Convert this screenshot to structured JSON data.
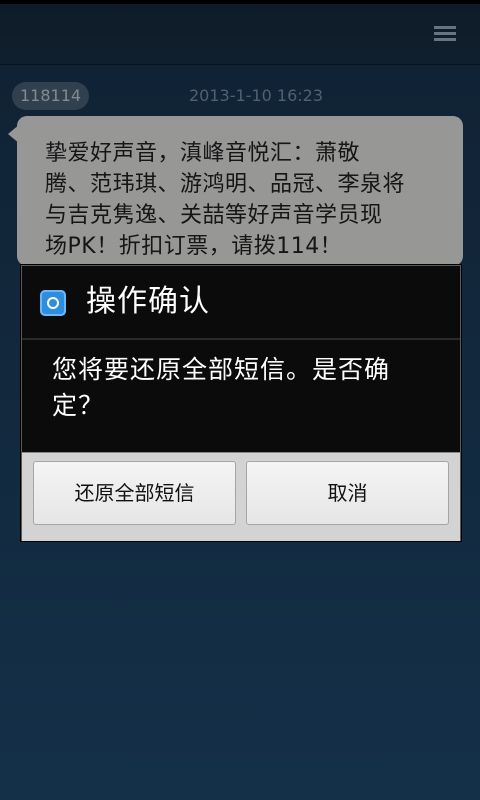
{
  "titlebar": {
    "menu_icon": "menu-icon"
  },
  "thread": {
    "sender": "118114",
    "timestamp": "2013-1-10 16:23",
    "message_lines": [
      "挚爱好声音，滇峰音悦汇：萧敬",
      "腾、范玮琪、游鸿明、品冠、李泉将",
      "与吉克隽逸、关喆等好声音学员现",
      "场PK！折扣订票，请拨114！"
    ]
  },
  "dialog": {
    "icon": "restore-icon",
    "title": "操作确认",
    "message_lines": [
      "您将要还原全部短信。是否确",
      "定？"
    ],
    "confirm_label": "还原全部短信",
    "cancel_label": "取消"
  },
  "colors": {
    "background": "#1c3d5c",
    "bubble": "#e9e9e7",
    "dialog_bg": "#0b0b0b",
    "accent_icon": "#2d8ee0"
  }
}
